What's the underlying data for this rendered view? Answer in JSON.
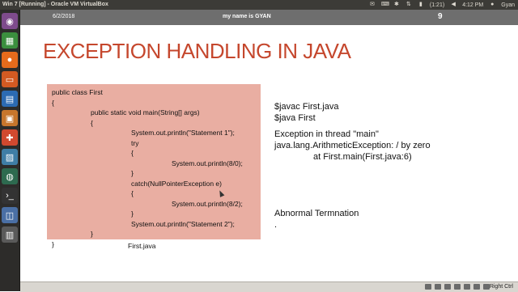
{
  "topbar": {
    "window_title": "Win 7 [Running] - Oracle VM VirtualBox",
    "battery": "(1:21)",
    "time": "4:12 PM",
    "user": "Gyan"
  },
  "launcher": {
    "items": [
      {
        "icon": "dash-icon",
        "color": "#7e4b8c"
      },
      {
        "icon": "spreadsheet-icon",
        "color": "#3b8f3e"
      },
      {
        "icon": "firefox-icon",
        "color": "#e66b1c"
      },
      {
        "icon": "presentation-icon",
        "color": "#d35a22"
      },
      {
        "icon": "writer-icon",
        "color": "#2c6bb3"
      },
      {
        "icon": "files-icon",
        "color": "#c7762c"
      },
      {
        "icon": "software-center-icon",
        "color": "#d1492f"
      },
      {
        "icon": "monitor-icon",
        "color": "#3f7ea6"
      },
      {
        "icon": "earth-icon",
        "color": "#2d6a4f"
      },
      {
        "icon": "terminal-icon",
        "color": "#333333"
      },
      {
        "icon": "virtualbox-icon",
        "color": "#4a6fa5"
      },
      {
        "icon": "trash-icon",
        "color": "#5a5a5a"
      }
    ]
  },
  "slide": {
    "date": "6/2/2018",
    "caption": "my name is GYAN",
    "page_number": "9",
    "title": "EXCEPTION HANDLING IN JAVA",
    "code_lines": [
      "public class First",
      "{",
      "public static void main(String[] args)",
      "{",
      "System.out.println(\"Statement 1\");",
      "try",
      "{",
      "System.out.println(8/0);",
      "}",
      "catch(NullPointerException e)",
      "{",
      "System.out.println(8/2);",
      "}",
      "System.out.println(\"Statement 2\");",
      "}",
      "}"
    ],
    "file_caption": "First.java",
    "output_lines": [
      "$javac First.java",
      "$java First",
      "Exception in thread \"main\"",
      "java.lang.ArithmeticException: / by zero",
      "at First.main(First.java:6)"
    ],
    "abnormal": "Abnormal Termnation",
    "dot": "."
  },
  "statusbar": {
    "host_key": "Right Ctrl"
  },
  "colors": {
    "title": "#c5472d",
    "code_background": "#e9aea2",
    "slide_header": "#6e6e6e",
    "topbar": "#3c3b37",
    "launcher": "#2d2c2a"
  }
}
